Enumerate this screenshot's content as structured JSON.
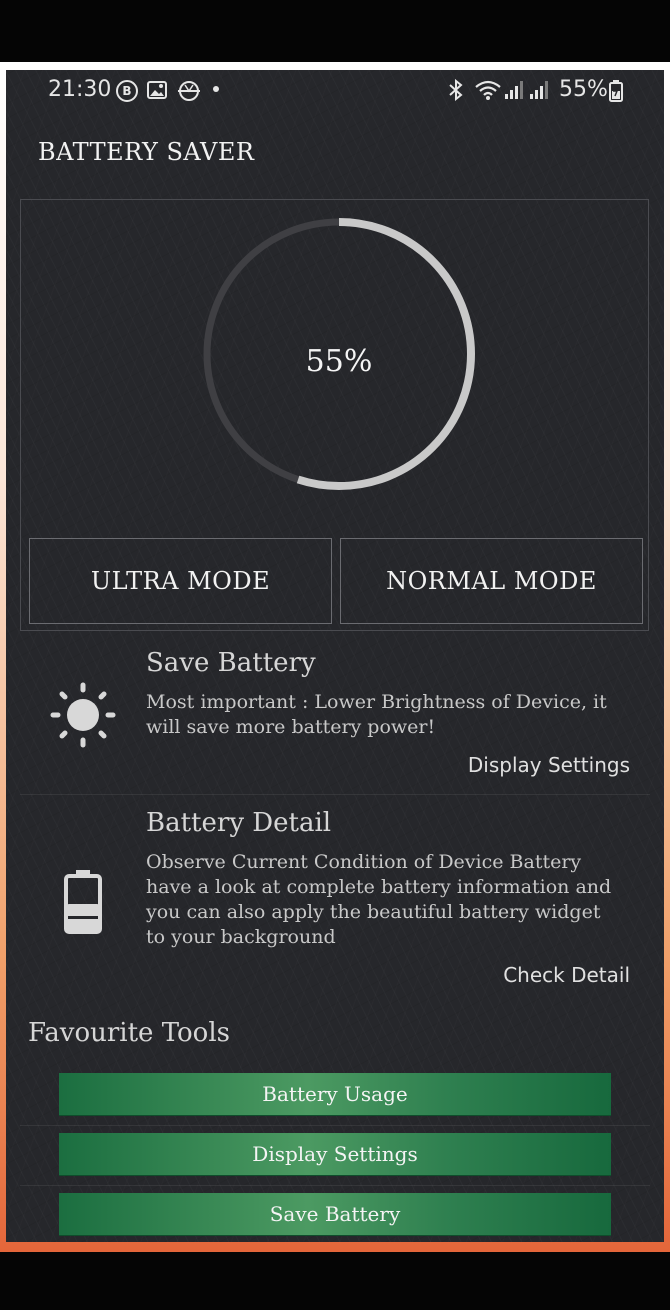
{
  "status_bar": {
    "time": "21:30",
    "b_badge": "B",
    "battery_percent": "55%"
  },
  "app": {
    "title": "BATTERY SAVER"
  },
  "gauge": {
    "level_percent": 55,
    "label": "55%",
    "colors": {
      "track": "#3f3f43",
      "fill": "#c9c9c9"
    }
  },
  "modes": {
    "ultra_label": "ULTRA MODE",
    "normal_label": "NORMAL MODE"
  },
  "cards": [
    {
      "icon": "sun-icon",
      "title": "Save Battery",
      "description_lines": [
        "Most important : Lower Brightness of Device, it",
        "will save more battery power!"
      ],
      "action": "Display Settings"
    },
    {
      "icon": "battery-icon",
      "title": "Battery Detail",
      "description_lines": [
        "Observe Current Condition of Device Battery",
        "have a look at complete battery information and",
        "you can also apply the beautiful battery widget",
        "to your background"
      ],
      "action": "Check Detail"
    }
  ],
  "favourite_tools": {
    "title": "Favourite Tools",
    "buttons": [
      "Battery Usage",
      "Display Settings",
      "Save Battery"
    ],
    "button_color": "#2f8050"
  }
}
